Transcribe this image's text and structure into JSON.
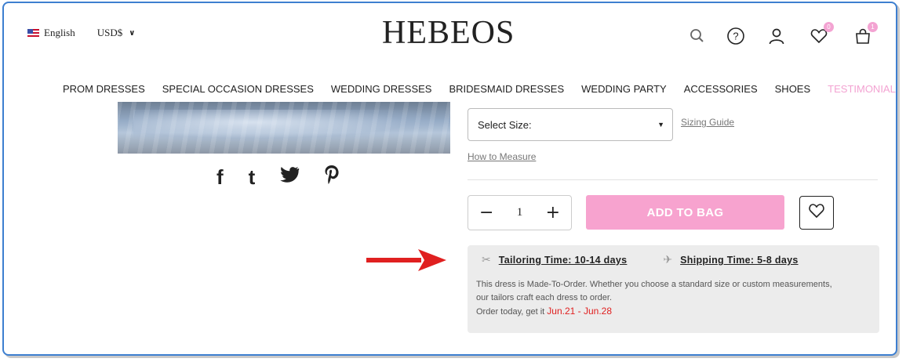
{
  "header": {
    "language": "English",
    "currency": "USD$",
    "logo": "HEBEOS",
    "wishlist_count": "0",
    "bag_count": "1"
  },
  "nav": {
    "items": [
      "PROM DRESSES",
      "SPECIAL OCCASION DRESSES",
      "WEDDING DRESSES",
      "BRIDESMAID DRESSES",
      "WEDDING PARTY",
      "ACCESSORIES",
      "SHOES"
    ],
    "active": "TESTIMONIALS"
  },
  "social": {
    "facebook": "f",
    "tumblr": "t"
  },
  "product": {
    "size_placeholder": "Select Size:",
    "sizing_guide": "Sizing Guide",
    "how_to_measure": "How to Measure",
    "quantity": "1",
    "add_to_bag": "ADD TO BAG"
  },
  "info": {
    "tailoring": "Tailoring Time: 10-14 days",
    "shipping": "Shipping Time: 5-8 days",
    "desc_line1": "This dress is Made-To-Order. Whether you choose a standard size or custom measurements,",
    "desc_line2": "our tailors craft each dress to order.",
    "order_prefix": "Order today, get it ",
    "order_dates": "Jun.21 - Jun.28"
  },
  "colors": {
    "accent_pink": "#f7a3cf",
    "frame_blue": "#3d7fd0",
    "date_red": "#e02020",
    "arrow_red": "#e02020"
  },
  "icons": [
    "flag-us-icon",
    "chevron-down-icon",
    "search-icon",
    "help-icon",
    "user-icon",
    "heart-icon",
    "bag-icon",
    "facebook-icon",
    "tumblr-icon",
    "twitter-icon",
    "pinterest-icon",
    "scissors-icon",
    "plane-icon",
    "arrow-right-icon"
  ]
}
